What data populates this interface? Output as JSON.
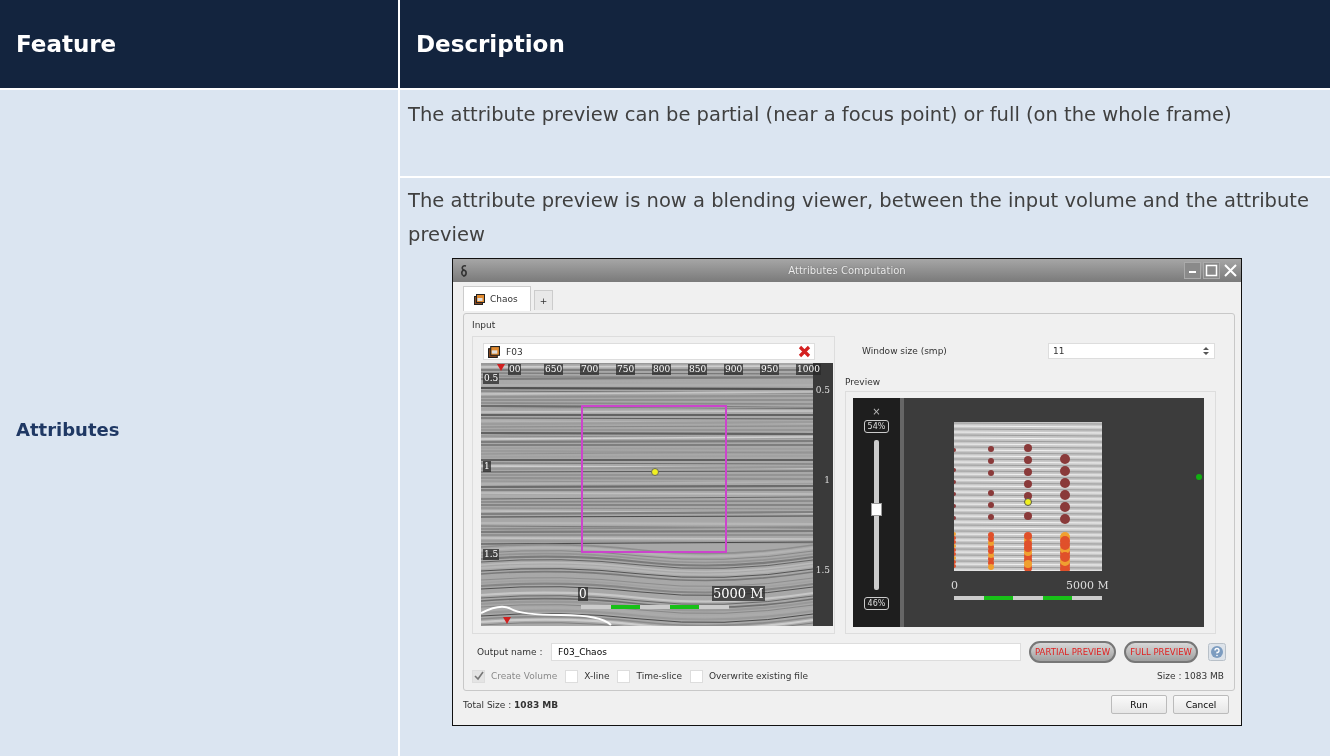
{
  "table": {
    "columns": [
      "Feature",
      "Description"
    ],
    "rows": [
      {
        "feature": "Attributes",
        "descriptions": [
          "The attribute preview can be partial (near a focus point) or full (on the whole frame)",
          "The attribute preview is now a blending viewer, between the input volume and the attribute preview"
        ]
      }
    ]
  },
  "screenshot": {
    "window": {
      "title": "Attributes Computation"
    },
    "tabs": [
      {
        "label": "Chaos",
        "selected": true
      },
      {
        "label": "+",
        "selected": false
      }
    ],
    "input": {
      "title": "Input",
      "volume_field": {
        "value": "F03"
      },
      "seismic_view": {
        "x_ticks": [
          "00",
          "650",
          "700",
          "750",
          "800",
          "850",
          "900",
          "950",
          "1000"
        ],
        "left_ticks": [
          "0.5",
          "1",
          "1.5"
        ],
        "right_ticks": [
          "0.5",
          "1",
          "1.5"
        ],
        "scale_start": "0",
        "scale_end": "5000 M"
      }
    },
    "window_size": {
      "label": "Window size (smp)",
      "value": "11"
    },
    "preview": {
      "title": "Preview",
      "blend": {
        "close": "×",
        "top_reading": "54%",
        "bottom_reading": "46%",
        "level": 0.54
      },
      "scale_start": "0",
      "scale_end": "5000 M"
    },
    "output_name": {
      "label": "Output name :",
      "value": "F03_Chaos"
    },
    "preview_buttons": [
      "PARTIAL PREVIEW",
      "FULL PREVIEW"
    ],
    "options": [
      {
        "label": "Create Volume",
        "checked": true,
        "disabled": true
      },
      {
        "label": "X-line",
        "checked": false,
        "disabled": false
      },
      {
        "label": "Time-slice",
        "checked": false,
        "disabled": false
      },
      {
        "label": "Overwrite existing file",
        "checked": false,
        "disabled": false
      }
    ],
    "size": "Size :  1083 MB",
    "total_size": "Total Size : **1083 MB**",
    "dialog_buttons": [
      "Run",
      "Cancel"
    ]
  }
}
